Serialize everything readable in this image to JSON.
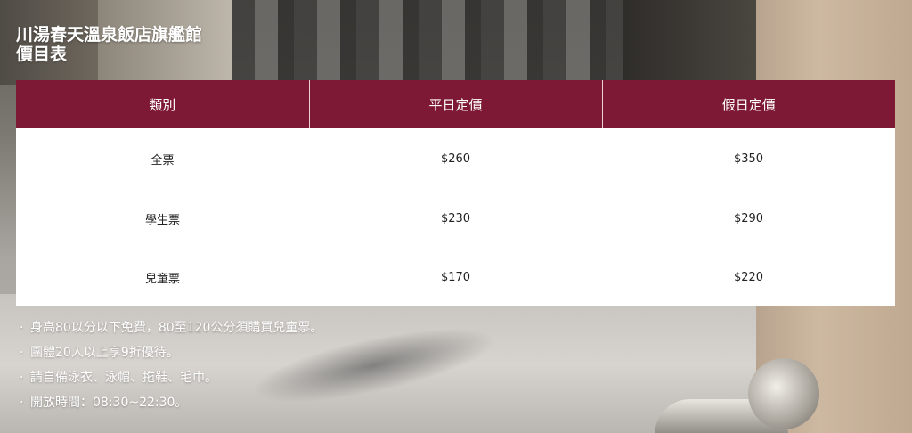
{
  "page": {
    "title_line1": "川湯春天溫泉飯店旗艦館",
    "title_line2": "價目表"
  },
  "table": {
    "header_color": "#7d1935",
    "columns": [
      "類別",
      "平日定價",
      "假日定價"
    ],
    "rows": [
      [
        "全票",
        "$260",
        "$350"
      ],
      [
        "學生票",
        "$230",
        "$290"
      ],
      [
        "兒童票",
        "$170",
        "$220"
      ]
    ]
  },
  "notes": {
    "bullet": "·",
    "items": [
      "身高80以分以下免費，80至120公分須購買兒童票。",
      "團體20人以上享9折優待。",
      "請自備泳衣、泳帽、拖鞋、毛巾。",
      "開放時間：08:30~22:30。"
    ]
  }
}
